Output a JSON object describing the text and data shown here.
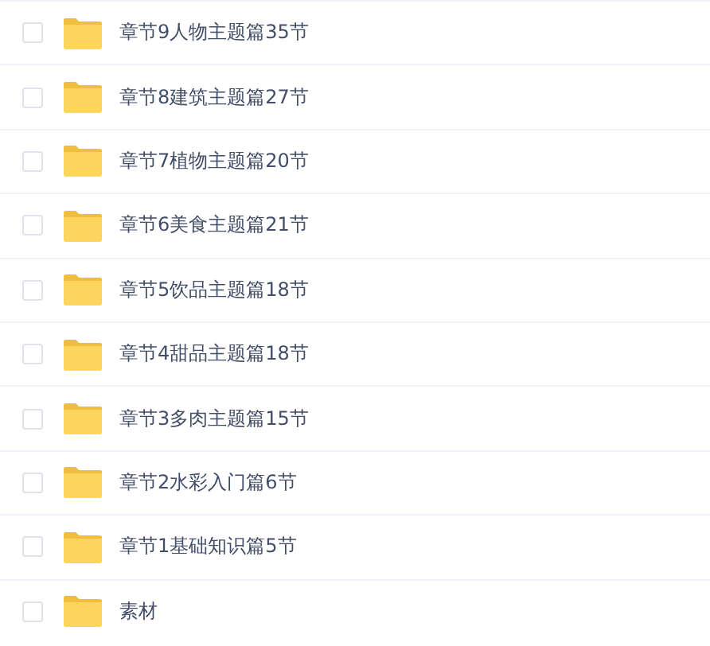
{
  "files": [
    {
      "name": "章节9人物主题篇35节",
      "checked": false
    },
    {
      "name": "章节8建筑主题篇27节",
      "checked": false
    },
    {
      "name": "章节7植物主题篇20节",
      "checked": false
    },
    {
      "name": "章节6美食主题篇21节",
      "checked": false
    },
    {
      "name": "章节5饮品主题篇18节",
      "checked": false
    },
    {
      "name": "章节4甜品主题篇18节",
      "checked": false
    },
    {
      "name": "章节3多肉主题篇15节",
      "checked": false
    },
    {
      "name": "章节2水彩入门篇6节",
      "checked": false
    },
    {
      "name": "章节1基础知识篇5节",
      "checked": false
    },
    {
      "name": "素材",
      "checked": false
    }
  ]
}
